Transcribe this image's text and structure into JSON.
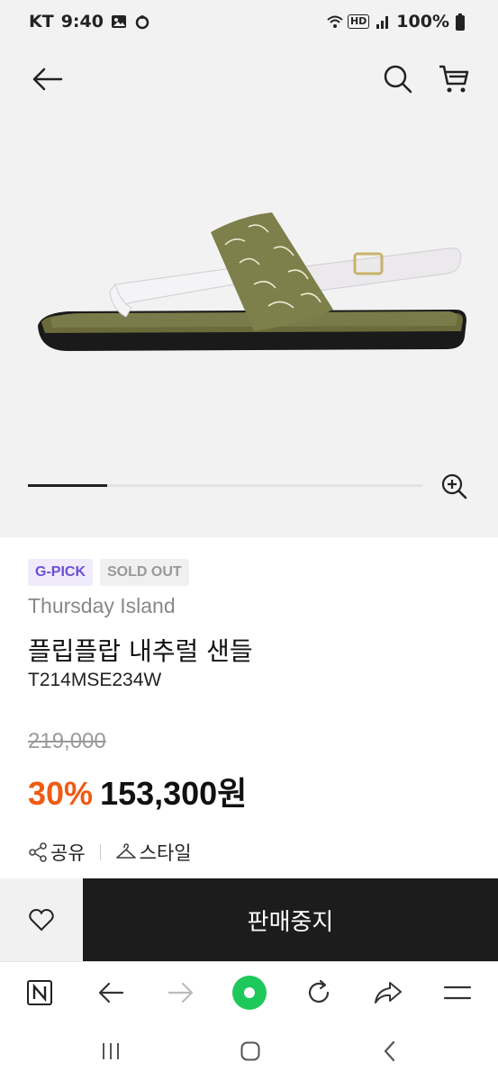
{
  "status_bar": {
    "carrier": "KT",
    "time": "9:40",
    "battery": "100%",
    "icons": [
      "image-icon",
      "bixby-icon",
      "wifi-icon",
      "hd-icon",
      "signal-icon",
      "battery-icon"
    ]
  },
  "header": {
    "icons": [
      "back-arrow-icon",
      "search-icon",
      "cart-icon"
    ]
  },
  "gallery": {
    "progress": 0.2,
    "zoom_icon": "zoom-in-icon"
  },
  "product": {
    "badges": [
      "G-PICK",
      "SOLD OUT"
    ],
    "brand": "Thursday Island",
    "name": "플립플랍 내추럴 샌들",
    "code": "T214MSE234W",
    "original_price": "219,000",
    "discount": "30%",
    "sale_price": "153,300원"
  },
  "actions": {
    "share": "공유",
    "style": "스타일"
  },
  "purchase": {
    "wish_icon": "heart-icon",
    "button_label": "판매중지"
  },
  "browser": {
    "icons": [
      "naver-icon",
      "back-icon",
      "forward-icon",
      "home-dot-icon",
      "refresh-icon",
      "share-icon",
      "menu-icon"
    ]
  },
  "system_nav": {
    "icons": [
      "recents-icon",
      "home-icon",
      "back-icon"
    ]
  },
  "colors": {
    "accent_discount": "#f05a14",
    "gpick": "#6a4fd8",
    "browser_green": "#1ec85a",
    "button_dark": "#1c1c1c"
  }
}
